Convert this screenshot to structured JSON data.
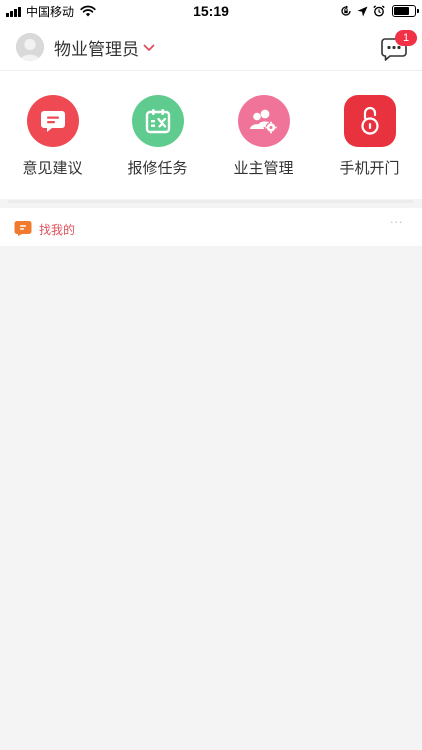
{
  "status_bar": {
    "carrier": "中国移动",
    "time": "15:19"
  },
  "header": {
    "role_label": "物业管理员",
    "message_badge": "1"
  },
  "quick_actions": [
    {
      "label": "意见建议",
      "icon": "suggestion-chat-icon",
      "color": "#ef4a53"
    },
    {
      "label": "报修任务",
      "icon": "calendar-repair-icon",
      "color": "#5fcb8e"
    },
    {
      "label": "业主管理",
      "icon": "owners-gear-icon",
      "color": "#f0749a"
    },
    {
      "label": "手机开门",
      "icon": "unlock-icon",
      "color": "#e8333f"
    }
  ],
  "section": {
    "title": "找我的",
    "more_label": "···"
  },
  "colors": {
    "accent": "#e0505b",
    "badge": "#f03146",
    "page_bg": "#f4f4f5"
  }
}
